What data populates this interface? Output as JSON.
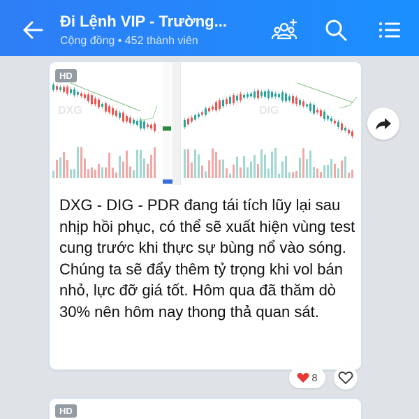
{
  "header": {
    "title": "Đi Lệnh VIP - Trường...",
    "subtitle": "Cộng đồng • 452 thành viên"
  },
  "icons": {
    "back": "arrow-left",
    "members": "add-member",
    "search": "search",
    "menu": "list-menu",
    "share": "share-arrow",
    "reaction": "heart",
    "like": "heart-outline"
  },
  "message": {
    "badge": "HD",
    "text": "DXG - DIG - PDR đang tái tích lũy lại sau nhịp hồi phục, có thể sẽ xuất hiện vùng test cung trước khi thực sự bùng nổ vào sóng. Chúng ta sẽ đẩy thêm tỷ trọng khi vol bán nhỏ, lực đỡ giá tốt. Hôm qua đã thăm dò 30% nên hôm nay thong thả quan sát.",
    "reaction_count": "8"
  },
  "next_message": {
    "badge": "HD"
  },
  "colors": {
    "header": "#2f7ef6",
    "up_candle": "#26a69a",
    "down_candle": "#ef5350",
    "reaction_heart": "#e53935"
  }
}
